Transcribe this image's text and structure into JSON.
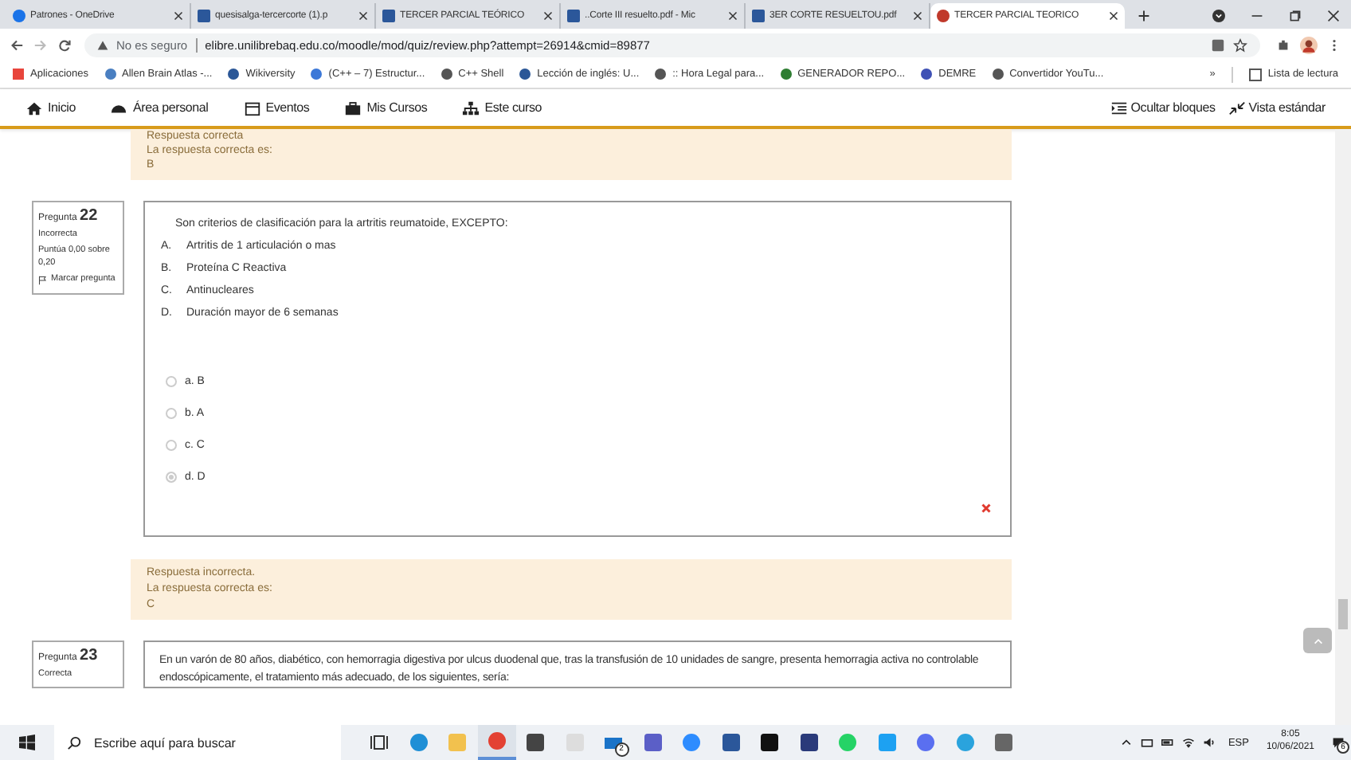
{
  "browser": {
    "tabs": [
      {
        "title": "Patrones - OneDrive",
        "kind": "cloud",
        "selected": false
      },
      {
        "title": "quesisalga-tercercorte (1).p",
        "kind": "doc",
        "selected": false
      },
      {
        "title": "TERCER PARCIAL TEÓRICO",
        "kind": "doc",
        "selected": false
      },
      {
        "title": "..Corte III resuelto.pdf - Mic",
        "kind": "doc",
        "selected": false
      },
      {
        "title": "3ER CORTE RESUELTOU.pdf",
        "kind": "doc",
        "selected": false
      },
      {
        "title": "TERCER PARCIAL TEORICO",
        "kind": "site",
        "selected": true
      }
    ],
    "security": "No es seguro",
    "url": "elibre.unilibrebaq.edu.co/moodle/mod/quiz/review.php?attempt=26914&cmid=89877",
    "bookmarks": [
      "Aplicaciones",
      "Allen Brain Atlas -...",
      "Wikiversity",
      "(C++ – 7) Estructur...",
      "C++ Shell",
      "Lección de inglés: U...",
      ":: Hora Legal para...",
      "GENERADOR REPO...",
      "DEMRE",
      "Convertidor YouTu..."
    ],
    "bookmarks_more": "»",
    "reading_list": "Lista de lectura"
  },
  "nav": {
    "items": [
      "Inicio",
      "Área personal",
      "Eventos",
      "Mis Cursos",
      "Este curso"
    ],
    "right": [
      "Ocultar bloques",
      "Vista estándar"
    ]
  },
  "previous_feedback": {
    "status": "Respuesta correcta",
    "correct_label": "La respuesta correcta es:",
    "answer": "B"
  },
  "questions": [
    {
      "label": "Pregunta",
      "number": "22",
      "state": "Incorrecta",
      "score": "Puntúa 0,00 sobre 0,20",
      "flag": "Marcar pregunta",
      "correct": false,
      "text": "Son criterios de clasificación para la artritis reumatoide, EXCEPTO:",
      "items": [
        {
          "letter": "A.",
          "text": "Artritis de 1 articulación o mas"
        },
        {
          "letter": "B.",
          "text": "Proteína C Reactiva"
        },
        {
          "letter": "C.",
          "text": "Antinucleares"
        },
        {
          "letter": "D.",
          "text": "Duración mayor de 6 semanas"
        }
      ],
      "options": [
        {
          "label": "a. B",
          "selected": false
        },
        {
          "label": "b. A",
          "selected": false
        },
        {
          "label": "c. C",
          "selected": false
        },
        {
          "label": "d. D",
          "selected": true
        }
      ],
      "feedback": {
        "status": "Respuesta incorrecta.",
        "correct_label": "La respuesta correcta es:",
        "answer": "C"
      }
    },
    {
      "label": "Pregunta",
      "number": "23",
      "state": "Correcta",
      "text": "En un varón de 80 años, diabético, con hemorragia digestiva por ulcus duodenal que, tras la transfusión de 10 unidades de sangre, presenta hemorragia activa no controlable endoscópicamente, el tratamiento más adecuado, de los siguientes, sería:"
    }
  ],
  "taskbar": {
    "search_placeholder": "Escribe aquí para buscar",
    "mail_badge": "2",
    "language": "ESP",
    "time": "8:05",
    "date": "10/06/2021",
    "notifications": "6"
  }
}
